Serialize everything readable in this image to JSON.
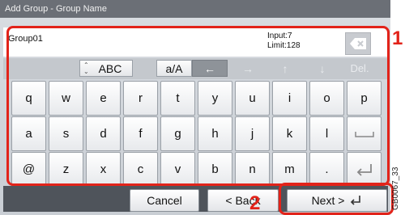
{
  "title": "Add Group - Group Name",
  "input": {
    "value": "Group01",
    "count_label": "Input:7",
    "limit_label": "Limit:128"
  },
  "toolbar": {
    "mode_label": "ABC",
    "case_label": "a/A",
    "delete_label": "Del."
  },
  "keys": {
    "row1": [
      "q",
      "w",
      "e",
      "r",
      "t",
      "y",
      "u",
      "i",
      "o",
      "p"
    ],
    "row2": [
      "a",
      "s",
      "d",
      "f",
      "g",
      "h",
      "j",
      "k",
      "l"
    ],
    "row3": [
      "@",
      "z",
      "x",
      "c",
      "v",
      "b",
      "n",
      "m",
      "."
    ]
  },
  "buttons": {
    "cancel": "Cancel",
    "back": "< Back",
    "next": "Next >"
  },
  "callouts": {
    "one": "1",
    "two": "2"
  },
  "figure_id": "GB0067_33",
  "colors": {
    "callout": "#e2231a",
    "title_bar": "#6b6f76",
    "bottom_bar": "#4f545b"
  }
}
